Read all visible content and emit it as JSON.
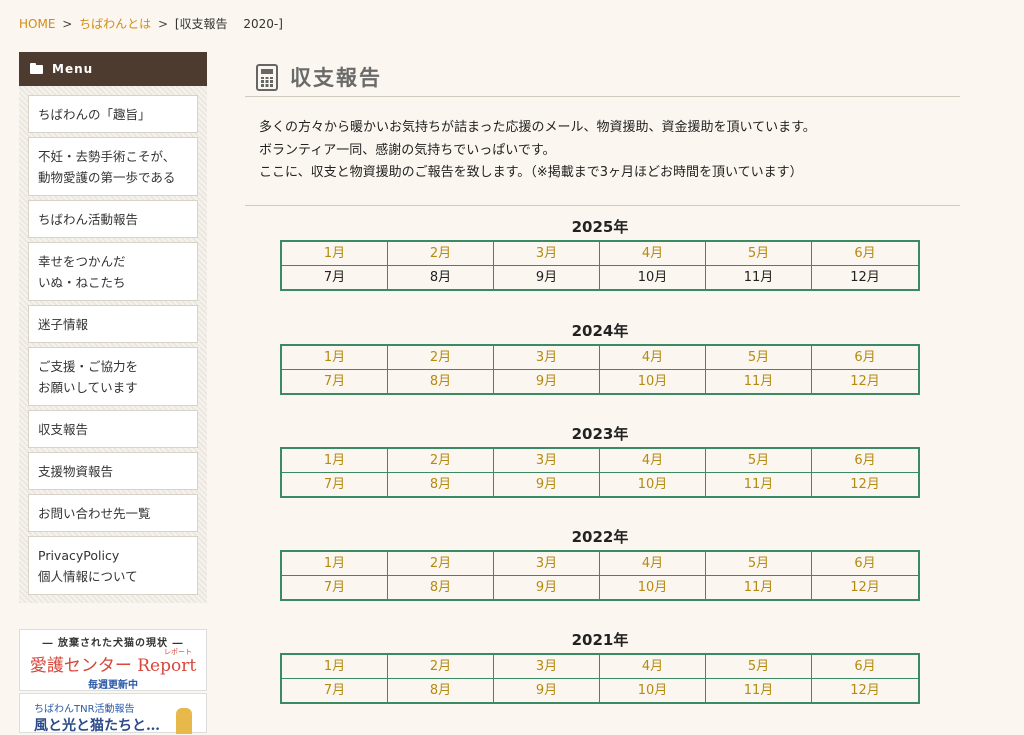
{
  "breadcrumb": {
    "home": "HOME",
    "sep": ">",
    "parent": "ちばわんとは",
    "current": "[収支報告　 2020-]"
  },
  "sidebar": {
    "heading": "Menu",
    "items": [
      {
        "label": "ちばわんの「趣旨」"
      },
      {
        "label": "不妊・去勢手術こそが、\n動物愛護の第一歩である"
      },
      {
        "label": "ちばわん活動報告"
      },
      {
        "label": "幸せをつかんだ\nいぬ・ねこたち"
      },
      {
        "label": "迷子情報"
      },
      {
        "label": "ご支援・ご協力を\nお願いしています"
      },
      {
        "label": "収支報告"
      },
      {
        "label": "支援物資報告"
      },
      {
        "label": "お問い合わせ先一覧"
      },
      {
        "label": "PrivacyPolicy\n個人情報について"
      }
    ],
    "banner1": {
      "sub": "― 放棄された犬猫の現状 ―",
      "main": "愛護センター Report",
      "ruby": "レポート",
      "weekly": "毎週更新中"
    },
    "banner2": {
      "sub": "ちばわんTNR活動報告",
      "main": "風と光と猫たちと…"
    }
  },
  "main": {
    "title": "収支報告",
    "intro": [
      "多くの方々から暖かいお気持ちが詰まった応援のメール、物資援助、資金援助を頂いています。",
      "ボランティア一同、感謝の気持ちでいっぱいです。",
      "ここに、収支と物資援助のご報告を致します。（※掲載まで3ヶ月ほどお時間を頂いています）"
    ],
    "years": [
      {
        "label": "2025年",
        "months": [
          "1月",
          "2月",
          "3月",
          "4月",
          "5月",
          "6月",
          "7月",
          "8月",
          "9月",
          "10月",
          "11月",
          "12月"
        ],
        "linked": 6
      },
      {
        "label": "2024年",
        "months": [
          "1月",
          "2月",
          "3月",
          "4月",
          "5月",
          "6月",
          "7月",
          "8月",
          "9月",
          "10月",
          "11月",
          "12月"
        ],
        "linked": 12
      },
      {
        "label": "2023年",
        "months": [
          "1月",
          "2月",
          "3月",
          "4月",
          "5月",
          "6月",
          "7月",
          "8月",
          "9月",
          "10月",
          "11月",
          "12月"
        ],
        "linked": 12
      },
      {
        "label": "2022年",
        "months": [
          "1月",
          "2月",
          "3月",
          "4月",
          "5月",
          "6月",
          "7月",
          "8月",
          "9月",
          "10月",
          "11月",
          "12月"
        ],
        "linked": 12
      },
      {
        "label": "2021年",
        "months": [
          "1月",
          "2月",
          "3月",
          "4月",
          "5月",
          "6月",
          "7月",
          "8月",
          "9月",
          "10月",
          "11月",
          "12月"
        ],
        "linked": 12
      }
    ]
  },
  "colors": {
    "link": "#d18c16",
    "month_link": "#b58a11",
    "table_border": "#3b8a63",
    "menu_header_bg": "#4d3b2f",
    "page_bg": "#fbf7f0"
  }
}
